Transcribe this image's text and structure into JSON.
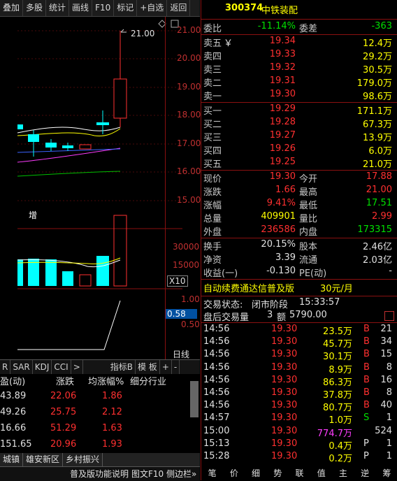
{
  "toolbar": {
    "items": [
      "叠加",
      "多股",
      "统计",
      "画线",
      "F10",
      "标记",
      "+自选",
      "返回"
    ]
  },
  "price_axis": [
    "21.00",
    "20.00",
    "19.00",
    "18.00",
    "17.00",
    "16.00",
    "15.00"
  ],
  "vol_axis": [
    "30000",
    "15000"
  ],
  "vol_unit": "X10",
  "ind_axis": [
    "1.00",
    "0.58",
    "0.50"
  ],
  "ind_current": "0.58",
  "peak_label": "21.00",
  "zeng_label": "增",
  "baixian": "日线",
  "stock": {
    "code": "300374",
    "name": "中铁装配"
  },
  "weibi": {
    "label": "委比",
    "value": "-11.14%",
    "label2": "委差",
    "value2": "-363"
  },
  "sell": [
    {
      "label": "卖五",
      "mark": "￥",
      "price": "19.34",
      "vol": "12.4万"
    },
    {
      "label": "卖四",
      "mark": "",
      "price": "19.33",
      "vol": "29.2万"
    },
    {
      "label": "卖三",
      "mark": "",
      "price": "19.32",
      "vol": "30.5万"
    },
    {
      "label": "卖二",
      "mark": "",
      "price": "19.31",
      "vol": "179.0万"
    },
    {
      "label": "卖一",
      "mark": "",
      "price": "19.30",
      "vol": "98.6万"
    }
  ],
  "buy": [
    {
      "label": "买一",
      "price": "19.29",
      "vol": "171.1万"
    },
    {
      "label": "买二",
      "price": "19.28",
      "vol": "67.3万"
    },
    {
      "label": "买三",
      "price": "19.27",
      "vol": "13.9万"
    },
    {
      "label": "买四",
      "price": "19.26",
      "vol": "6.0万"
    },
    {
      "label": "买五",
      "price": "19.25",
      "vol": "21.0万"
    }
  ],
  "quote": [
    {
      "l": "现价",
      "v": "19.30",
      "l2": "今开",
      "v2": "17.88",
      "c": "red",
      "c2": "red"
    },
    {
      "l": "涨跌",
      "v": "1.66",
      "l2": "最高",
      "v2": "21.00",
      "c": "red",
      "c2": "red"
    },
    {
      "l": "涨幅",
      "v": "9.41%",
      "l2": "最低",
      "v2": "17.51",
      "c": "red",
      "c2": "grn"
    },
    {
      "l": "总量",
      "v": "409901",
      "l2": "量比",
      "v2": "2.99",
      "c": "yel",
      "c2": "red"
    },
    {
      "l": "外盘",
      "v": "236586",
      "l2": "内盘",
      "v2": "173315",
      "c": "red",
      "c2": "grn"
    }
  ],
  "fund": [
    {
      "l": "换手",
      "v": "20.15%",
      "l2": "股本",
      "v2": "2.46亿"
    },
    {
      "l": "净资",
      "v": "3.39",
      "l2": "流通",
      "v2": "2.03亿"
    },
    {
      "l": "收益(一)",
      "v": "-0.130",
      "l2": "PE(动)",
      "v2": "-"
    }
  ],
  "promo": {
    "text": "自动续费通达信普及版",
    "price": "30元/月"
  },
  "trade_status": {
    "label": "交易状态:",
    "value": "闭市阶段",
    "time": "15:33:57"
  },
  "after_hours": {
    "label": "盘后交易量",
    "vol": "3",
    "amount_label": "额",
    "amount": "5790.00"
  },
  "ticks": [
    {
      "t": "14:56",
      "p": "19.30",
      "v": "23.5万",
      "bs": "B",
      "n": "21"
    },
    {
      "t": "14:56",
      "p": "19.30",
      "v": "45.7万",
      "bs": "B",
      "n": "34"
    },
    {
      "t": "14:56",
      "p": "19.30",
      "v": "30.1万",
      "bs": "B",
      "n": "15"
    },
    {
      "t": "14:56",
      "p": "19.30",
      "v": "8.9万",
      "bs": "B",
      "n": "8"
    },
    {
      "t": "14:56",
      "p": "19.30",
      "v": "86.3万",
      "bs": "B",
      "n": "16"
    },
    {
      "t": "14:56",
      "p": "19.30",
      "v": "37.8万",
      "bs": "B",
      "n": "8"
    },
    {
      "t": "14:56",
      "p": "19.30",
      "v": "80.7万",
      "bs": "B",
      "n": "40"
    },
    {
      "t": "14:57",
      "p": "19.30",
      "v": "1.0万",
      "bs": "S",
      "n": "1"
    },
    {
      "t": "15:00",
      "p": "19.30",
      "v": "774.7万",
      "bs": "",
      "n": "524"
    },
    {
      "t": "15:13",
      "p": "19.30",
      "v": "0.4万",
      "bs": "P",
      "n": "1"
    },
    {
      "t": "15:28",
      "p": "19.30",
      "v": "0.2万",
      "bs": "P",
      "n": "1"
    }
  ],
  "right_tabs": [
    "笔",
    "价",
    "细",
    "势",
    "联",
    "值",
    "主",
    "逆",
    "筹"
  ],
  "ind_tabs": [
    "R",
    "SAR",
    "KDJ",
    "CCI",
    ">",
    "指标B",
    "模 板",
    "+",
    "-"
  ],
  "table_header": [
    "盈(动)",
    "涨跌",
    "均涨幅%",
    "细分行业"
  ],
  "table_rows": [
    {
      "pe": "43.89",
      "chg": "22.06",
      "avg": "1.86"
    },
    {
      "pe": "49.26",
      "chg": "25.75",
      "avg": "2.12"
    },
    {
      "pe": "16.66",
      "chg": "51.29",
      "avg": "1.63"
    },
    {
      "pe": "151.65",
      "chg": "20.96",
      "avg": "1.93"
    }
  ],
  "sheet_tabs": [
    "城镇",
    "雄安新区",
    "乡村振兴"
  ],
  "status_items": [
    "普及版功能说明",
    "图文F10",
    "侧边栏»"
  ],
  "colors": {
    "red": "#ff3030",
    "green": "#00e000",
    "cyan": "#00ffff",
    "yellow": "#ffff00",
    "border": "#8a1010"
  }
}
